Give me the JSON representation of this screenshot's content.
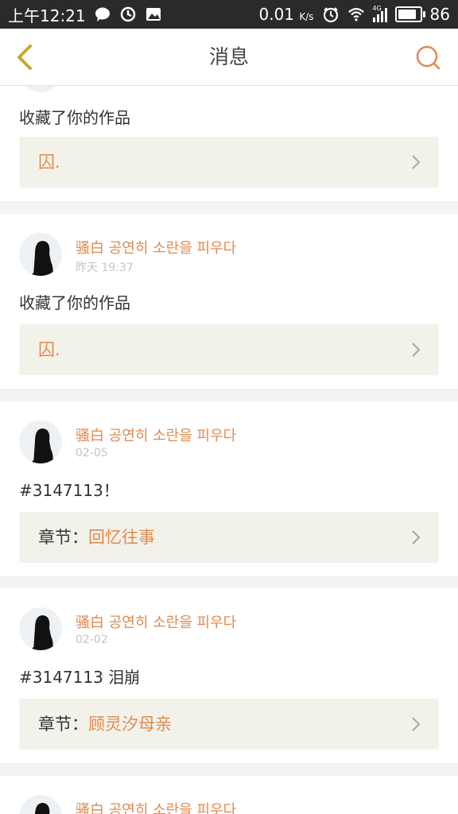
{
  "status_bar": {
    "time": "上午12:21",
    "speed": "0.01",
    "speed_unit": "K/s",
    "network": "4G",
    "battery": "86",
    "battery_level": 0.86
  },
  "header": {
    "title": "消息"
  },
  "colors": {
    "accent": "#e08a4f",
    "back_icon": "#c9a531",
    "work_box_bg": "#f3f2ea"
  },
  "messages": [
    {
      "user": "",
      "time": "",
      "content": "收藏了你的作品",
      "work_prefix": "",
      "work_title": "囚."
    },
    {
      "user": "骚白 공연히 소란을 피우다",
      "time": "昨天 19:37",
      "content": "收藏了你的作品",
      "work_prefix": "",
      "work_title": "囚."
    },
    {
      "user": "骚白 공연히 소란을 피우다",
      "time": "02-05",
      "content": "#3147113！",
      "work_prefix": "章节：",
      "work_title": "回忆往事"
    },
    {
      "user": "骚白 공연히 소란을 피우다",
      "time": "02-02",
      "content": "#3147113 泪崩",
      "work_prefix": "章节：",
      "work_title": "顾灵汐母亲"
    },
    {
      "user": "骚白 공연히 소란을 피우다",
      "time": "",
      "content": "",
      "work_prefix": "",
      "work_title": ""
    }
  ]
}
